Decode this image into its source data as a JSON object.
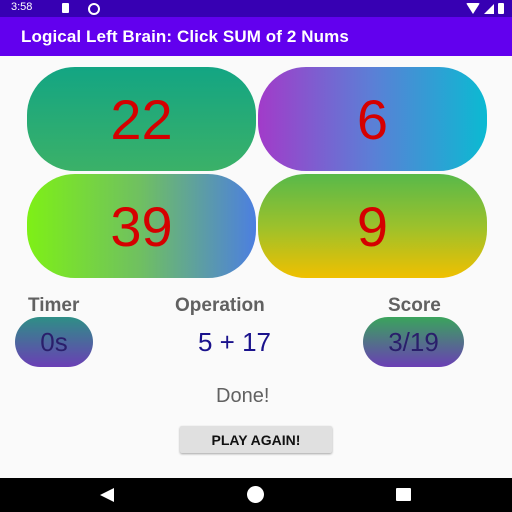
{
  "status_bar": {
    "time": "3:58"
  },
  "app_bar": {
    "title": "Logical Left Brain: Click SUM of 2 Nums"
  },
  "tiles": [
    {
      "value": "22"
    },
    {
      "value": "6"
    },
    {
      "value": "39"
    },
    {
      "value": "9"
    }
  ],
  "timer": {
    "label": "Timer",
    "value": "0s"
  },
  "operation": {
    "label": "Operation",
    "value": "5 + 17"
  },
  "score": {
    "label": "Score",
    "value": "3/19"
  },
  "result": {
    "message": "Done!"
  },
  "play_again": {
    "label": "PLAY AGAIN!"
  },
  "colors": {
    "status_bar": "#3700b3",
    "app_bar": "#6200ee",
    "tile_number": "#d50000",
    "operation_text": "#1a128c"
  }
}
